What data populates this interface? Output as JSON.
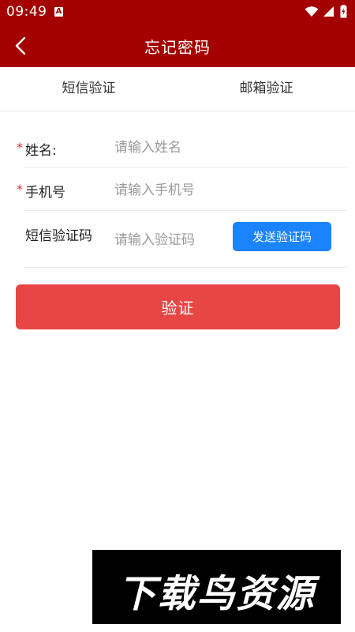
{
  "status_bar": {
    "time": "09:49",
    "badge": "A",
    "icons": [
      "wifi-icon",
      "signal-icon",
      "battery-icon"
    ]
  },
  "app_bar": {
    "title": "忘记密码",
    "back_icon": "chevron-left-icon",
    "background_color": "#a50000"
  },
  "tabs": [
    {
      "label": "短信验证"
    },
    {
      "label": "邮箱验证"
    }
  ],
  "form": {
    "required_mark": "*",
    "name": {
      "label": "姓名:",
      "placeholder": "请输入姓名",
      "value": ""
    },
    "phone": {
      "label": "手机号",
      "placeholder": "请输入手机号",
      "value": ""
    },
    "sms_code": {
      "label": "短信验证码",
      "placeholder": "请输入验证码",
      "value": "",
      "send_button": "发送验证码"
    }
  },
  "verify_button": "验证",
  "watermark": "下载鸟资源",
  "colors": {
    "brand": "#a50000",
    "send_button": "#1a84ff",
    "verify_button": "#e84545",
    "required": "#d32f2f"
  }
}
